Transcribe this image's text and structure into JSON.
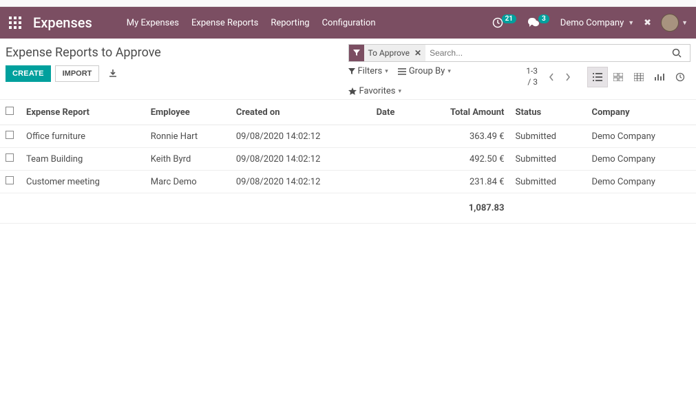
{
  "nav": {
    "brand": "Expenses",
    "links": [
      "My Expenses",
      "Expense Reports",
      "Reporting",
      "Configuration"
    ],
    "activity_count": "21",
    "msg_count": "3",
    "company": "Demo Company"
  },
  "page": {
    "title": "Expense Reports to Approve",
    "create_label": "CREATE",
    "import_label": "IMPORT"
  },
  "search": {
    "facet_label": "To Approve",
    "placeholder": "Search...",
    "filters_label": "Filters",
    "groupby_label": "Group By",
    "favorites_label": "Favorites",
    "pager_range": "1-3",
    "pager_total": "/ 3"
  },
  "table": {
    "headers": {
      "report": "Expense Report",
      "employee": "Employee",
      "created": "Created on",
      "date": "Date",
      "amount": "Total Amount",
      "status": "Status",
      "company": "Company"
    },
    "rows": [
      {
        "report": "Office furniture",
        "employee": "Ronnie Hart",
        "created": "09/08/2020 14:02:12",
        "date": "",
        "amount": "363.49 €",
        "status": "Submitted",
        "company": "Demo Company"
      },
      {
        "report": "Team Building",
        "employee": "Keith Byrd",
        "created": "09/08/2020 14:02:12",
        "date": "",
        "amount": "492.50 €",
        "status": "Submitted",
        "company": "Demo Company"
      },
      {
        "report": "Customer meeting",
        "employee": "Marc Demo",
        "created": "09/08/2020 14:02:12",
        "date": "",
        "amount": "231.84 €",
        "status": "Submitted",
        "company": "Demo Company"
      }
    ],
    "total": "1,087.83"
  }
}
